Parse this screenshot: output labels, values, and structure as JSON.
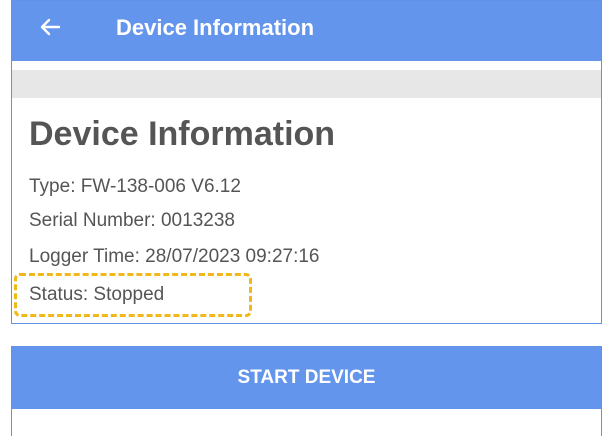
{
  "app_bar": {
    "title": "Device Information",
    "back_icon": "arrow-left-icon",
    "color": "#6495ED"
  },
  "device_info": {
    "heading": "Device Information",
    "type": "Type: FW-138-006 V6.12",
    "serial_number": "Serial Number:  0013238",
    "logger_time": "Logger Time: 28/07/2023 09:27:16",
    "status": "Status: Stopped"
  },
  "highlight_color": "#F0B818",
  "actions": {
    "start_device_label": "START DEVICE",
    "button_color": "#6495ED"
  }
}
